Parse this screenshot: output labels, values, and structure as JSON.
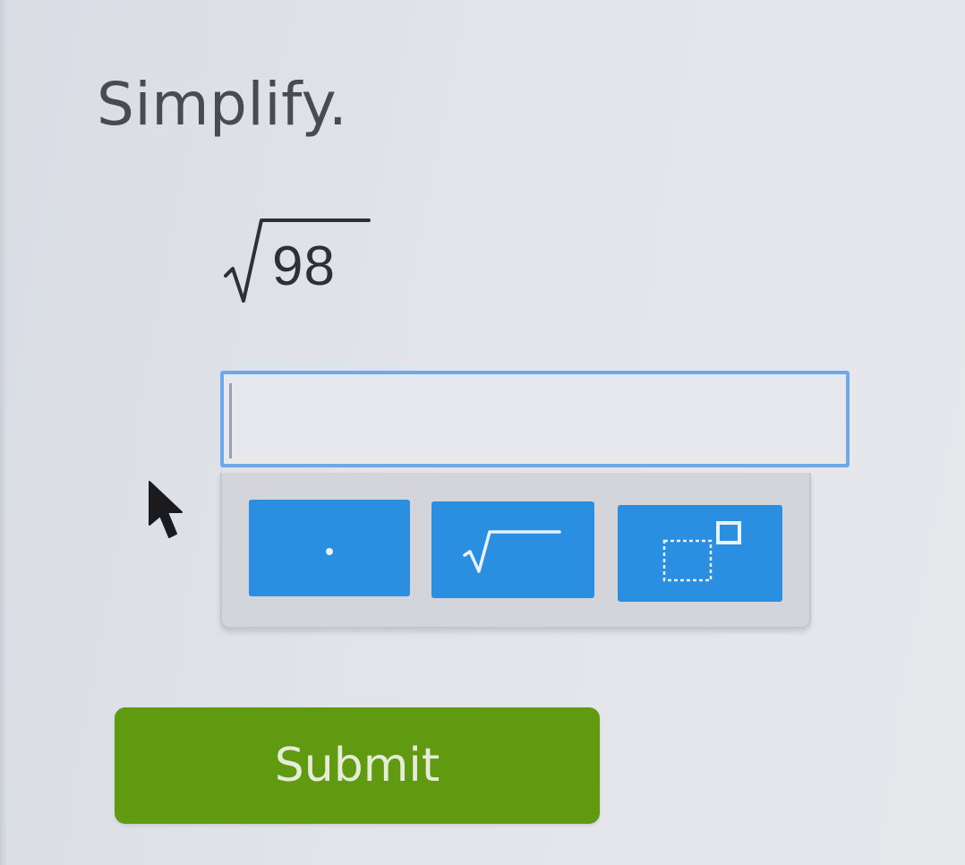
{
  "problem": {
    "instruction": "Simplify.",
    "radicand": "98"
  },
  "answer": {
    "value": "",
    "placeholder": ""
  },
  "keypad": {
    "keys": [
      {
        "name": "decimal-point",
        "icon": "dot-icon"
      },
      {
        "name": "square-root",
        "icon": "sqrt-icon"
      },
      {
        "name": "exponent",
        "icon": "superscript-box-icon"
      }
    ]
  },
  "actions": {
    "submit_label": "Submit"
  },
  "colors": {
    "key_blue": "#2a8fe0",
    "submit_green": "#5f9a10",
    "input_border": "#6fa8e6",
    "text_dark": "#4a4a52"
  }
}
